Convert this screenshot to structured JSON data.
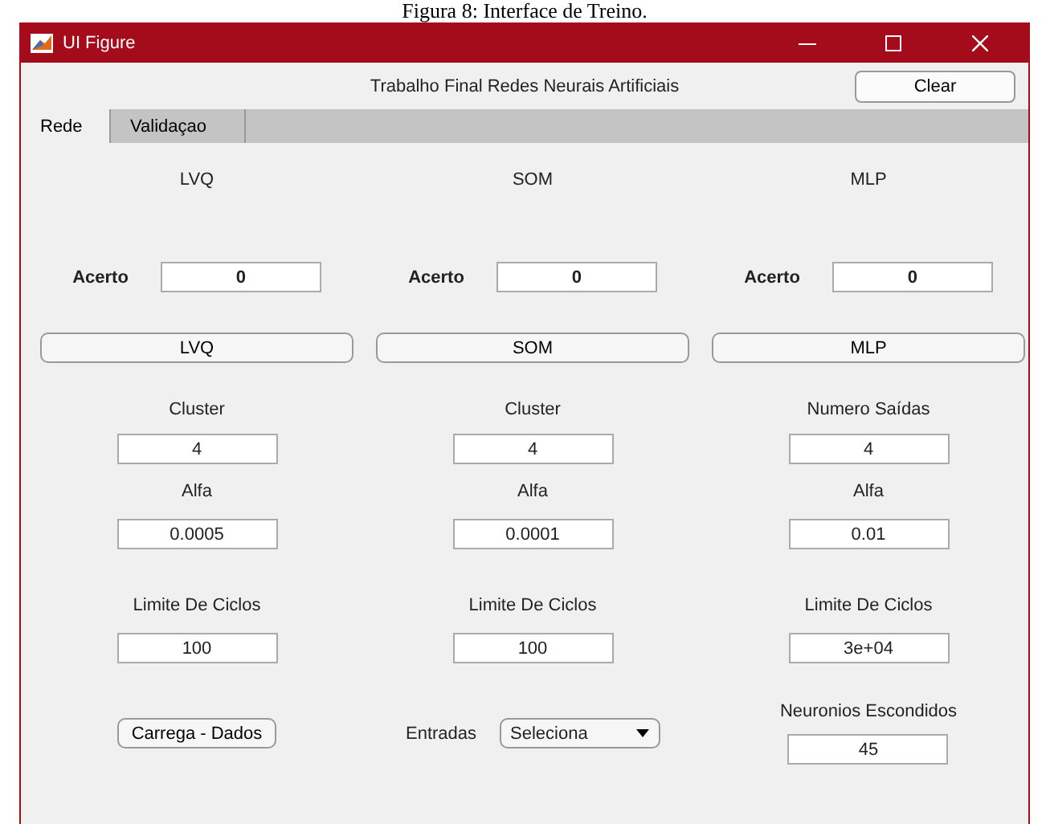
{
  "caption": "Figura 8: Interface de Treino.",
  "window": {
    "title": "UI Figure"
  },
  "header": {
    "title": "Trabalho Final Redes Neurais Artificiais",
    "clear_button": "Clear"
  },
  "tabs": [
    {
      "label": "Rede",
      "selected": true
    },
    {
      "label": "Validaçao",
      "selected": false
    }
  ],
  "columns": [
    {
      "title": "LVQ",
      "accuracy_label": "Acerto",
      "accuracy": "0",
      "button": "LVQ",
      "fields": [
        {
          "label": "Cluster",
          "value": "4"
        },
        {
          "label": "Alfa",
          "value": "0.0005"
        },
        {
          "label": "Limite De Ciclos",
          "value": "100"
        }
      ],
      "extra": {
        "kind": "button",
        "label": "Carrega - Dados"
      }
    },
    {
      "title": "SOM",
      "accuracy_label": "Acerto",
      "accuracy": "0",
      "button": "SOM",
      "fields": [
        {
          "label": "Cluster",
          "value": "4"
        },
        {
          "label": "Alfa",
          "value": "0.0001"
        },
        {
          "label": "Limite De Ciclos",
          "value": "100"
        }
      ],
      "extra": {
        "kind": "dropdown",
        "label": "Entradas",
        "value": "Seleciona"
      }
    },
    {
      "title": "MLP",
      "accuracy_label": "Acerto",
      "accuracy": "0",
      "button": "MLP",
      "fields": [
        {
          "label": "Numero Saídas",
          "value": "4"
        },
        {
          "label": "Alfa",
          "value": "0.01"
        },
        {
          "label": "Limite De Ciclos",
          "value": "3e+04"
        }
      ],
      "extra": {
        "kind": "field",
        "label": "Neuronios Escondidos",
        "value": "45"
      }
    }
  ]
}
